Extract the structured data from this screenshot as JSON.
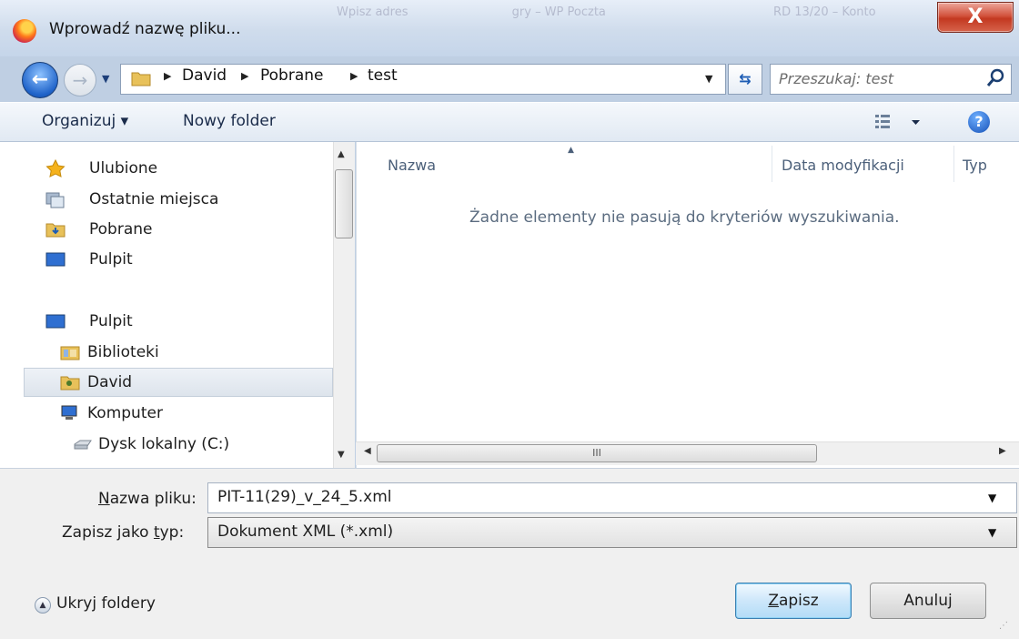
{
  "window": {
    "title": "Wprowadź nazwę pliku...",
    "close_label": "X"
  },
  "background_tabs": [
    "Wpisz adres",
    "gry – WP Poczta",
    "RD 13/20 – Konto"
  ],
  "address_bar": {
    "crumbs": [
      "David",
      "Pobrane",
      "test"
    ],
    "search_placeholder": "Przeszukaj: test"
  },
  "toolbar": {
    "organize_label": "Organizuj ▾",
    "new_folder_label": "Nowy folder",
    "help_label": "?"
  },
  "nav": {
    "items": [
      {
        "label": "Ulubione",
        "icon": "star-icon"
      },
      {
        "label": "Ostatnie miejsca",
        "icon": "recent-places-icon"
      },
      {
        "label": "Pobrane",
        "icon": "downloads-folder-icon"
      },
      {
        "label": "Pulpit",
        "icon": "desktop-icon"
      },
      {
        "label": "Pulpit",
        "icon": "desktop-icon"
      },
      {
        "label": "Biblioteki",
        "icon": "libraries-icon"
      },
      {
        "label": "David",
        "icon": "user-folder-icon"
      },
      {
        "label": "Komputer",
        "icon": "computer-icon"
      },
      {
        "label": "Dysk lokalny (C:)",
        "icon": "drive-icon"
      }
    ],
    "selected_label": "David"
  },
  "columns": [
    "Nazwa",
    "Data modyfikacji",
    "Typ"
  ],
  "empty_message": "Żadne elementy nie pasują do kryteriów wyszukiwania.",
  "hscroll_grip": "III",
  "form": {
    "filename_label_u": "N",
    "filename_label_rest": "azwa pliku:",
    "filename_value": "PIT-11(29)_v_24_5.xml",
    "type_label_pre": "Zapisz jako ",
    "type_label_u": "t",
    "type_label_rest": "yp:",
    "type_value": "Dokument XML (*.xml)"
  },
  "buttons": {
    "save_u": "Z",
    "save_rest": "apisz",
    "cancel": "Anuluj",
    "hide_folders": "Ukryj foldery"
  },
  "colors": {
    "accent": "#1f63c9",
    "close": "#c33820",
    "selection": "#dde4ec"
  }
}
